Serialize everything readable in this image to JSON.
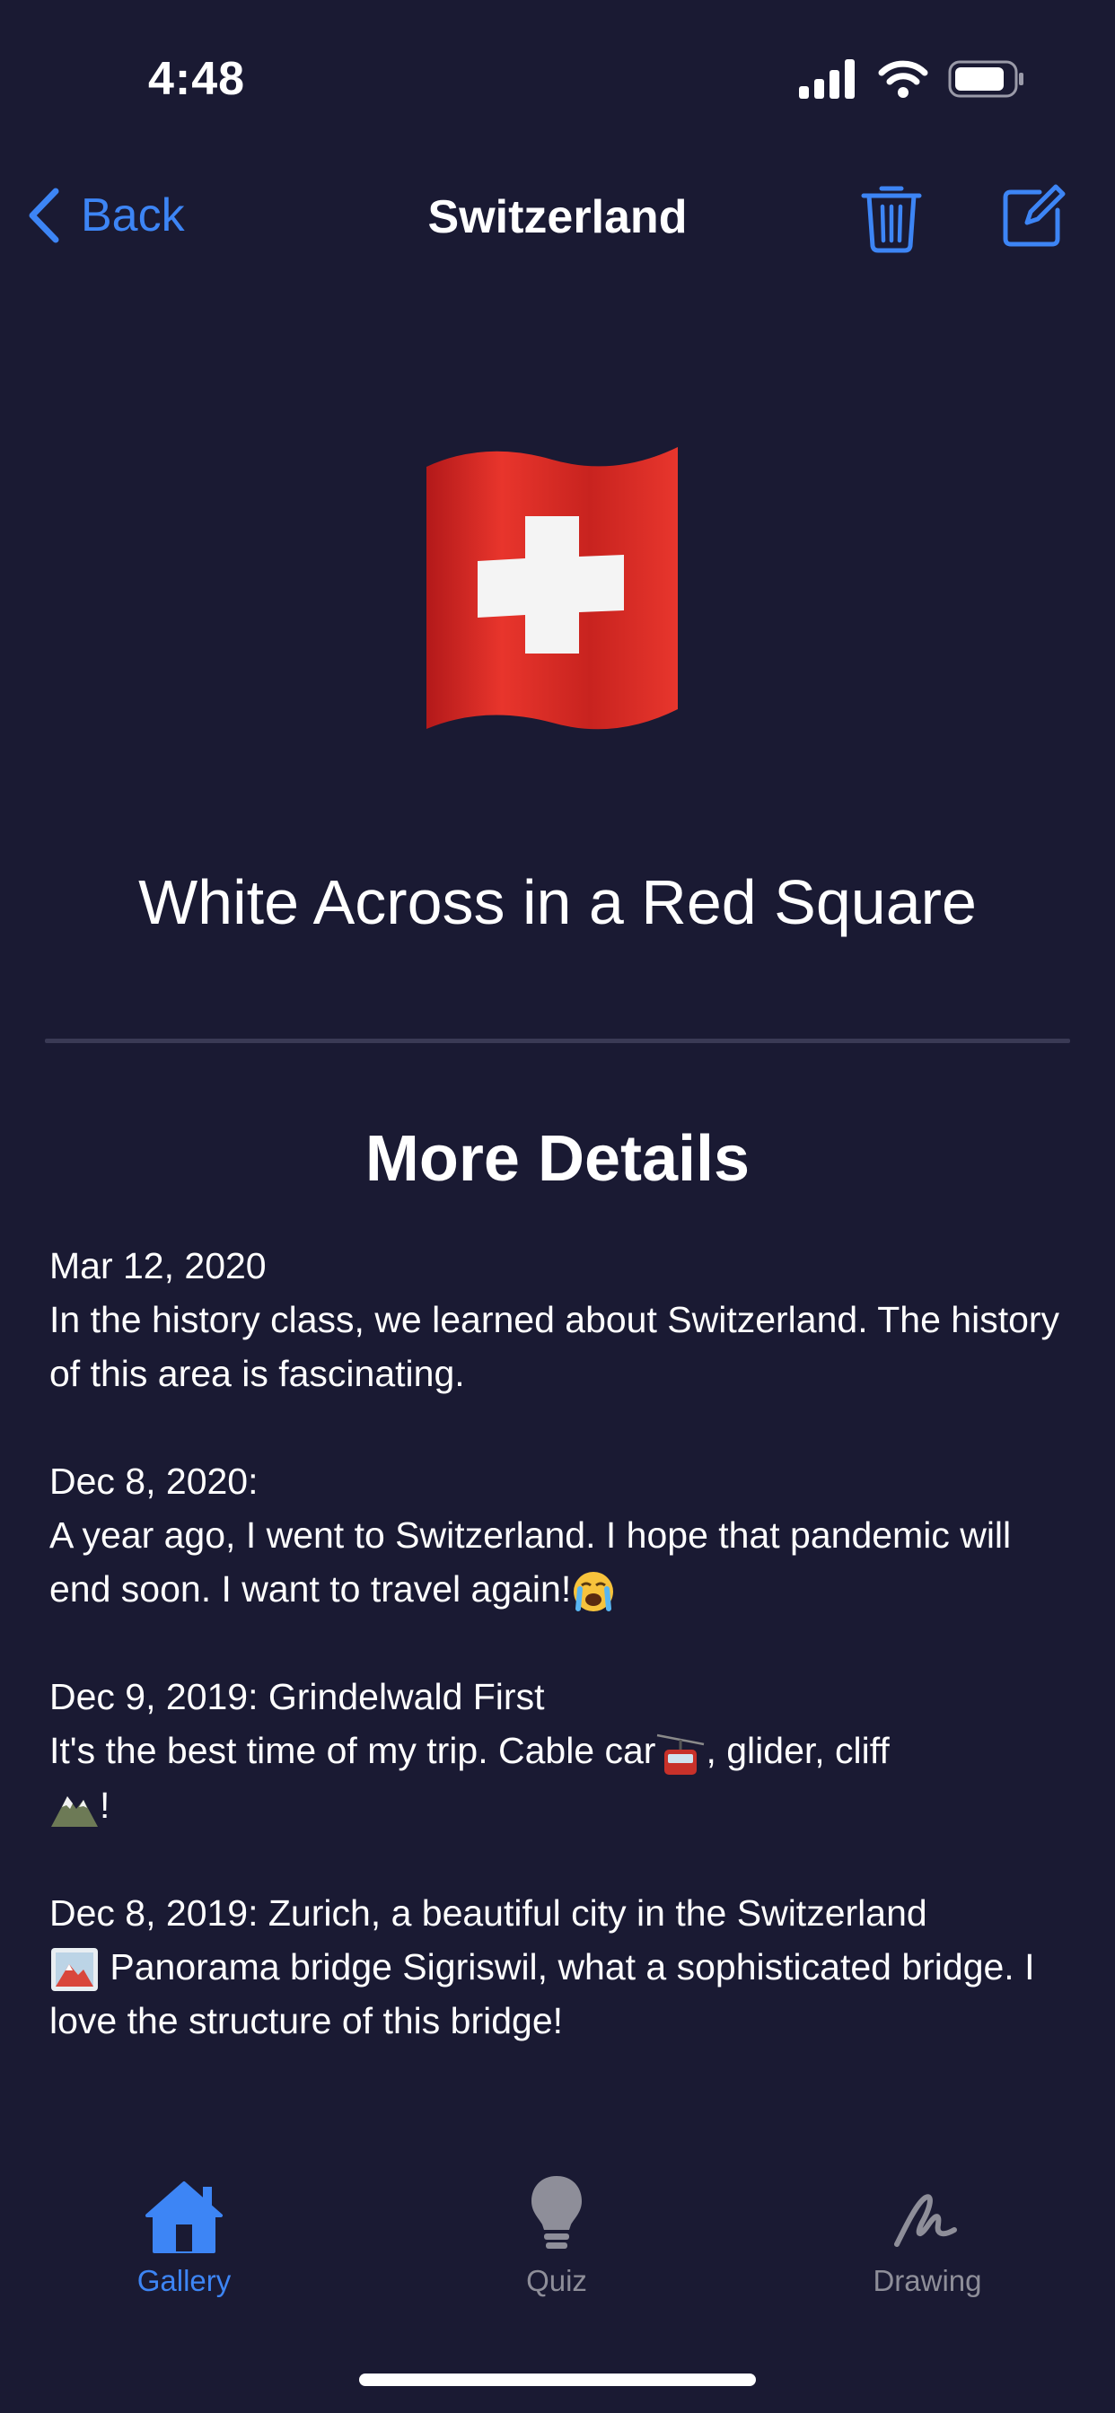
{
  "status_bar": {
    "time": "4:48"
  },
  "nav": {
    "back_label": "Back",
    "title": "Switzerland"
  },
  "flag": {
    "icon": "swiss-flag-emoji",
    "colors": {
      "red": "#d52b1e",
      "white": "#ffffff"
    }
  },
  "headline": "White Across in a Red Square",
  "section_title": "More Details",
  "entries": [
    {
      "date": "Mar 12, 2020",
      "text": "In the history class, we learned about Switzerland. The history of this area is fascinating."
    },
    {
      "date": "Dec 8, 2020:",
      "text": "A year ago, I went to Switzerland. I hope that pandemic will end soon. I want to travel again!"
    },
    {
      "date": "Dec 9, 2019: Grindelwald First",
      "text_a": "It's the best time of my trip. Cable car",
      "text_b": ", glider, cliff",
      "text_c": "!"
    },
    {
      "date": "Dec 8, 2019: Zurich, a beautiful city in the Switzerland",
      "text": " Panorama bridge Sigriswil, what a sophisticated bridge. I love the structure of this bridge!"
    }
  ],
  "tabs": [
    {
      "label": "Gallery",
      "icon": "house-icon",
      "active": true
    },
    {
      "label": "Quiz",
      "icon": "lightbulb-icon",
      "active": false
    },
    {
      "label": "Drawing",
      "icon": "scribble-icon",
      "active": false
    }
  ],
  "colors": {
    "background": "#1a1a33",
    "accent": "#3d85f5",
    "inactive": "#8e8e99"
  }
}
